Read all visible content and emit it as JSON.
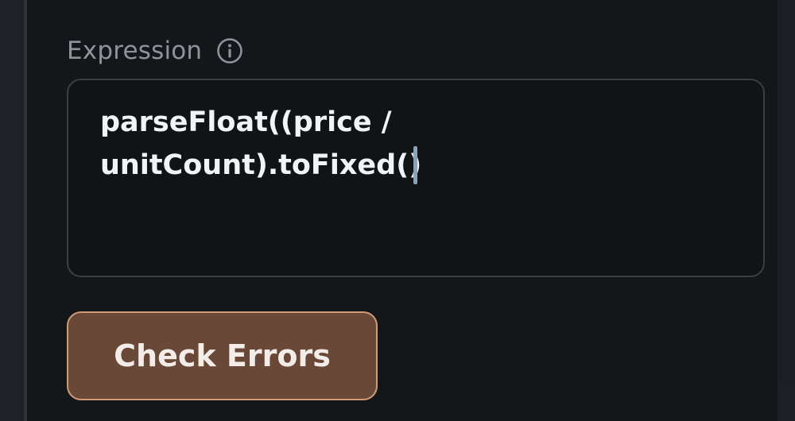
{
  "expression_field": {
    "label": "Expression",
    "value_line1": "parseFloat((price /",
    "value_line2": "unitCount).toFixed()",
    "info_icon": "info-circle-icon"
  },
  "actions": {
    "check_errors_label": "Check Errors"
  },
  "colors": {
    "panel_bg": "#14171a",
    "input_border": "#3a3f46",
    "button_bg": "#6a4837",
    "button_border": "#d39a79",
    "label": "#8e949c",
    "caret": "#8fa1b5"
  }
}
